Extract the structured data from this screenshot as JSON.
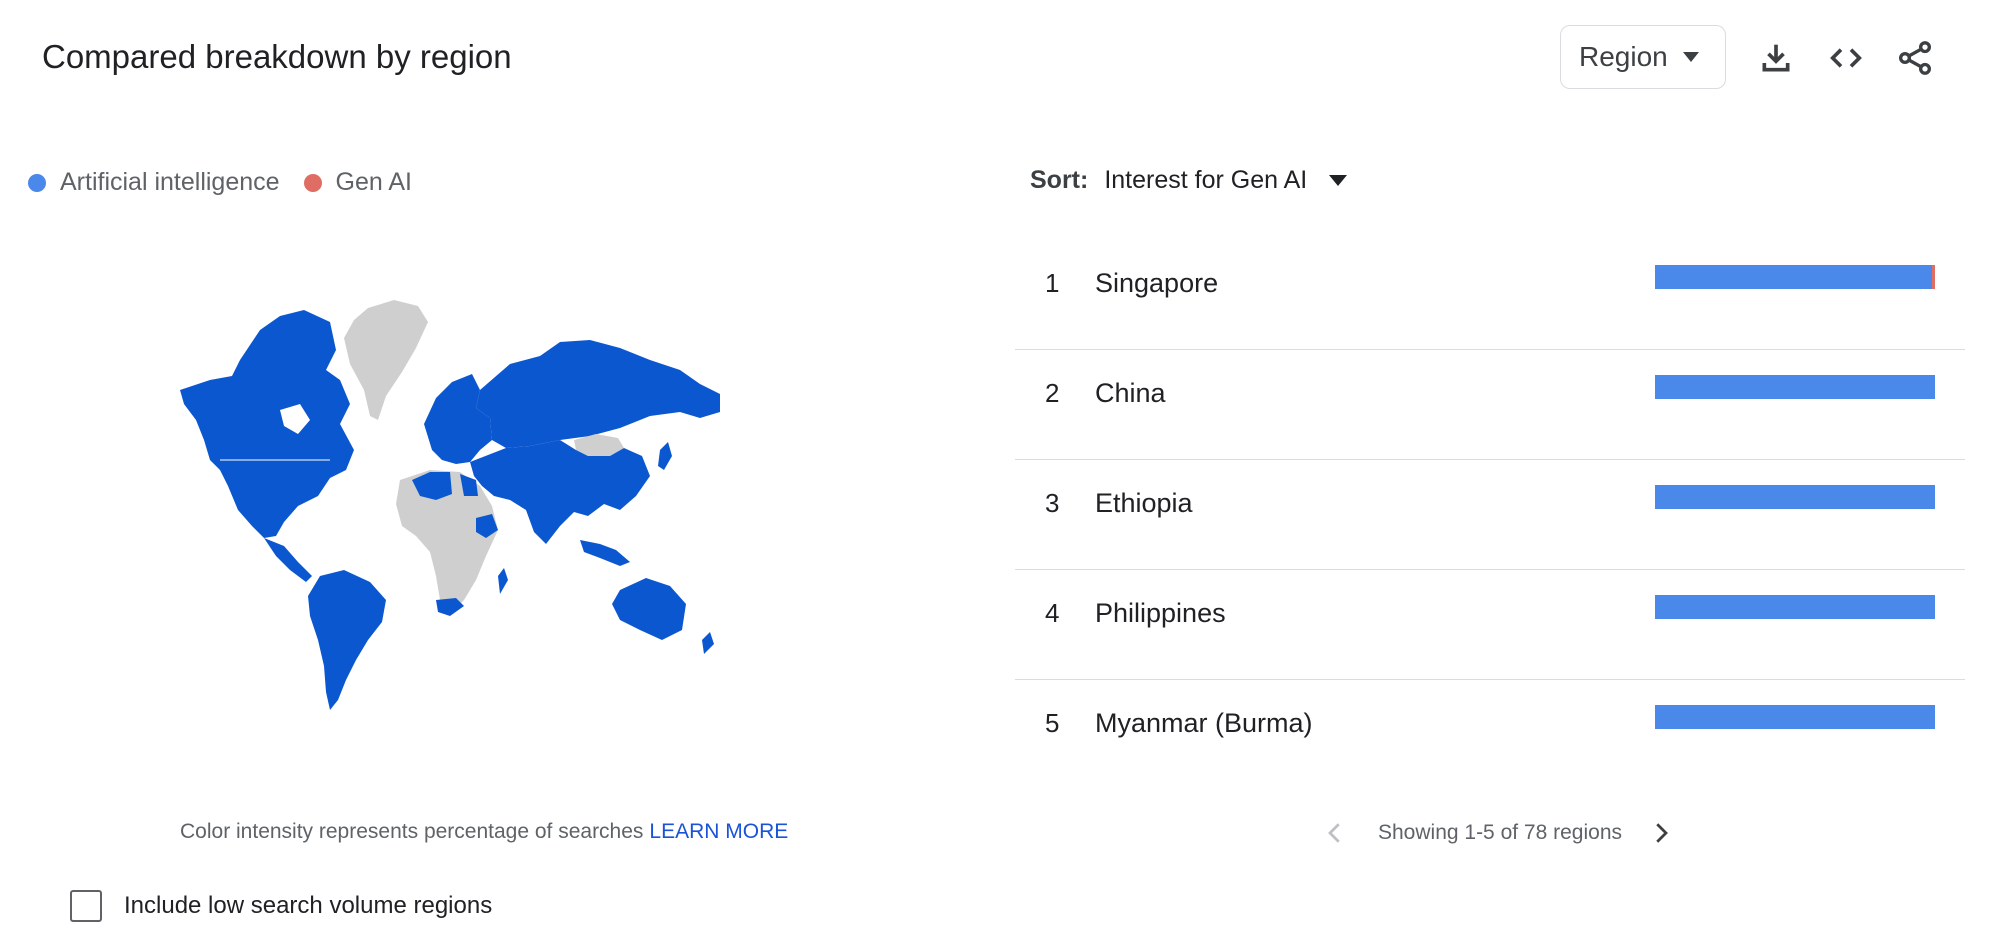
{
  "header": {
    "title": "Compared breakdown by region",
    "region_select": "Region",
    "icons": [
      "download-icon",
      "embed-code-icon",
      "share-icon"
    ]
  },
  "legend": [
    {
      "label": "Artificial intelligence",
      "color": "#4a89ea"
    },
    {
      "label": "Gen AI",
      "color": "#e06d64"
    }
  ],
  "map": {
    "highlight_color": "#0b57d0",
    "no_data_color": "#cfcfcf",
    "note": "Color intensity represents percentage of searches",
    "learn_more": "LEARN MORE"
  },
  "checkbox": {
    "label": "Include low search volume regions",
    "checked": false
  },
  "sort": {
    "label": "Sort:",
    "value": "Interest for Gen AI"
  },
  "rows": [
    {
      "rank": "1",
      "name": "Singapore",
      "ai_share": 0.99,
      "genai_share": 0.01
    },
    {
      "rank": "2",
      "name": "China",
      "ai_share": 1.0,
      "genai_share": 0.0
    },
    {
      "rank": "3",
      "name": "Ethiopia",
      "ai_share": 1.0,
      "genai_share": 0.0
    },
    {
      "rank": "4",
      "name": "Philippines",
      "ai_share": 1.0,
      "genai_share": 0.0
    },
    {
      "rank": "5",
      "name": "Myanmar (Burma)",
      "ai_share": 1.0,
      "genai_share": 0.0
    }
  ],
  "pagination": {
    "text": "Showing 1-5 of 78 regions"
  }
}
